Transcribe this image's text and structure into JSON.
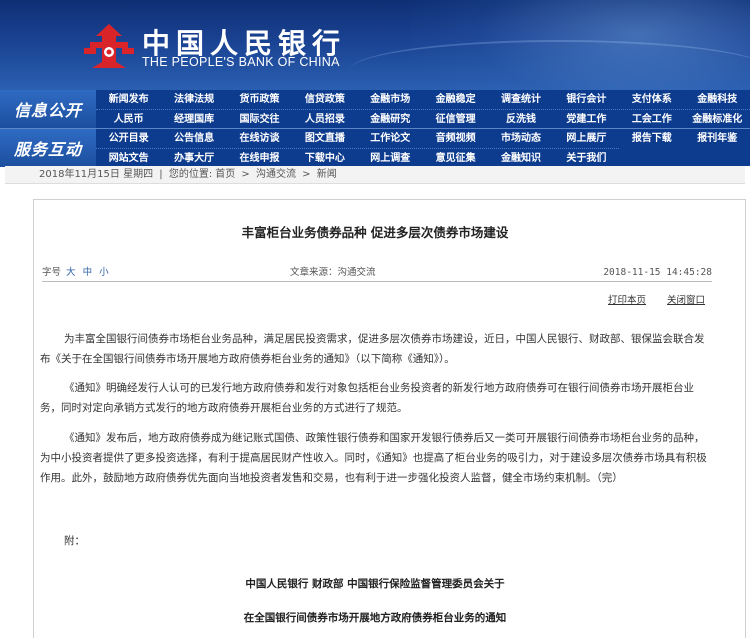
{
  "header": {
    "bank_name_cn": "中国人民银行",
    "bank_name_en": "THE PEOPLE'S BANK OF CHINA",
    "logo_icon": "pboc-emblem-icon",
    "colors": {
      "banner": "#1a4292",
      "nav": "#0d3c8f",
      "logo": "#d9252a"
    }
  },
  "nav": {
    "section1_label": "信息公开",
    "section2_label": "服务互动",
    "row1": [
      "新闻发布",
      "法律法规",
      "货币政策",
      "信贷政策",
      "金融市场",
      "金融稳定",
      "调查统计",
      "银行会计",
      "支付体系",
      "金融科技"
    ],
    "row2": [
      "人民币",
      "经理国库",
      "国际交往",
      "人员招录",
      "金融研究",
      "征信管理",
      "反洗钱",
      "党建工作",
      "工会工作",
      "金融标准化"
    ],
    "row3": [
      "公开目录",
      "公告信息",
      "在线访谈",
      "图文直播",
      "工作论文",
      "音频视频",
      "市场动态",
      "网上展厅",
      "报告下载",
      "报刊年鉴"
    ],
    "row4": [
      "网站文告",
      "办事大厅",
      "在线申报",
      "下载中心",
      "网上调查",
      "意见征集",
      "金融知识",
      "关于我们"
    ]
  },
  "breadcrumb": {
    "date": "2018年11月15日 星期四",
    "sep": "|",
    "location_label": "您的位置:",
    "home": "首页",
    "arrow": ">",
    "level1": "沟通交流",
    "level2": "新闻"
  },
  "article": {
    "title": "丰富柜台业务债券品种 促进多层次债券市场建设",
    "font_size_label": "字号",
    "font_sizes": [
      "大",
      "中",
      "小"
    ],
    "source": "文章来源：沟通交流",
    "datetime": "2018-11-15 14:45:28",
    "print_label": "打印本页",
    "close_label": "关闭窗口",
    "paragraphs": [
      "为丰富全国银行间债券市场柜台业务品种，满足居民投资需求，促进多层次债券市场建设，近日，中国人民银行、财政部、银保监会联合发布《关于在全国银行间债券市场开展地方政府债券柜台业务的通知》（以下简称《通知》）。",
      "《通知》明确经发行人认可的已发行地方政府债券和发行对象包括柜台业务投资者的新发行地方政府债券可在银行间债券市场开展柜台业务，同时对定向承销方式发行的地方政府债券开展柜台业务的方式进行了规范。",
      "《通知》发布后，地方政府债券成为继记账式国债、政策性银行债券和国家开发银行债券后又一类可开展银行间债券市场柜台业务的品种，为中小投资者提供了更多投资选择，有利于提高居民财产性收入。同时，《通知》也提高了柜台业务的吸引力，对于建设多层次债券市场具有积极作用。此外，鼓励地方政府债券优先面向当地投资者发售和交易，也有利于进一步强化投资人监督，健全市场约束机制。（完）"
    ],
    "attachment_label": "附：",
    "attachment_title_1": "中国人民银行 财政部 中国银行保险监督管理委员会关于",
    "attachment_title_2": "在全国银行间债券市场开展地方政府债券柜台业务的通知"
  }
}
